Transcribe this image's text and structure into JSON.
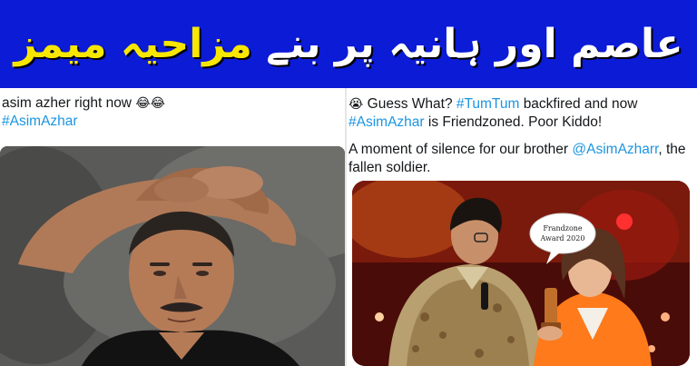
{
  "banner": {
    "title_white": "عاصم اور ہانیہ پر بنے",
    "title_yellow": "مزاحیہ میمز",
    "bg_color": "#0b1bd6",
    "white_color": "#ffffff",
    "yellow_color": "#f7e700"
  },
  "left_tweet": {
    "text": "asim azher right now",
    "emoji": "😂😂",
    "hashtag": "#AsimAzhar"
  },
  "right_tweet": {
    "emoji": "😭",
    "line1_a": "Guess What?",
    "hashtag1": "#TumTum",
    "line1_b": "backfired and now",
    "hashtag2": "#AsimAzhar",
    "line1_c": "is Friendzoned. Poor Kiddo!",
    "line2_a": "A moment of silence for our brother",
    "mention": "@AsimAzharr",
    "line2_b": ", the fallen soldier.",
    "bubble_line1": "Frandzone",
    "bubble_line2": "Award 2020",
    "hashtag_color": "#1b95e0"
  }
}
